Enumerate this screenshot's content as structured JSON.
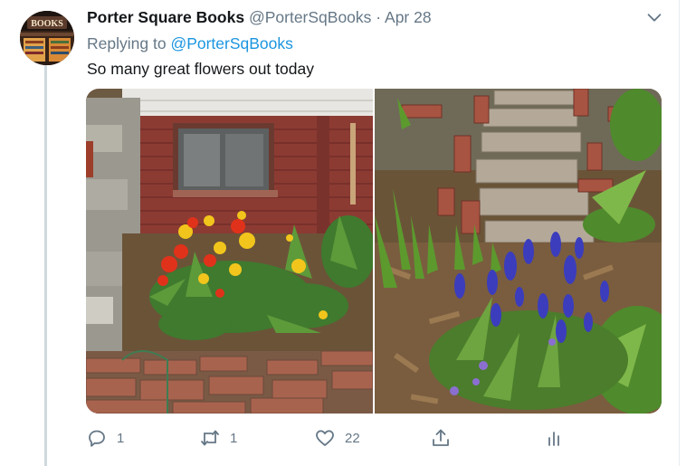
{
  "tweet": {
    "author": {
      "display_name": "Porter Square Books",
      "handle": "@PorterSqBooks",
      "avatar_sign_text": "BOOKS"
    },
    "separator": "·",
    "date": "Apr 28",
    "replying_to_label": "Replying to",
    "replying_to_handle": "@PorterSqBooks",
    "text": "So many great flowers out today",
    "media": [
      {
        "subject": "red and yellow tulips and daffodils by a brick wall"
      },
      {
        "subject": "purple grape hyacinths beside a brick garden path"
      }
    ]
  },
  "actions": {
    "reply_count": "1",
    "retweet_count": "1",
    "like_count": "22"
  },
  "icons": {
    "reply": "reply-icon",
    "retweet": "retweet-icon",
    "like": "heart-icon",
    "share": "share-icon",
    "analytics": "analytics-icon",
    "more": "chevron-down-icon"
  },
  "colors": {
    "link": "#1b95e0",
    "secondary_text": "#657786",
    "primary_text": "#14171a",
    "thread_line": "#cfd9de"
  }
}
